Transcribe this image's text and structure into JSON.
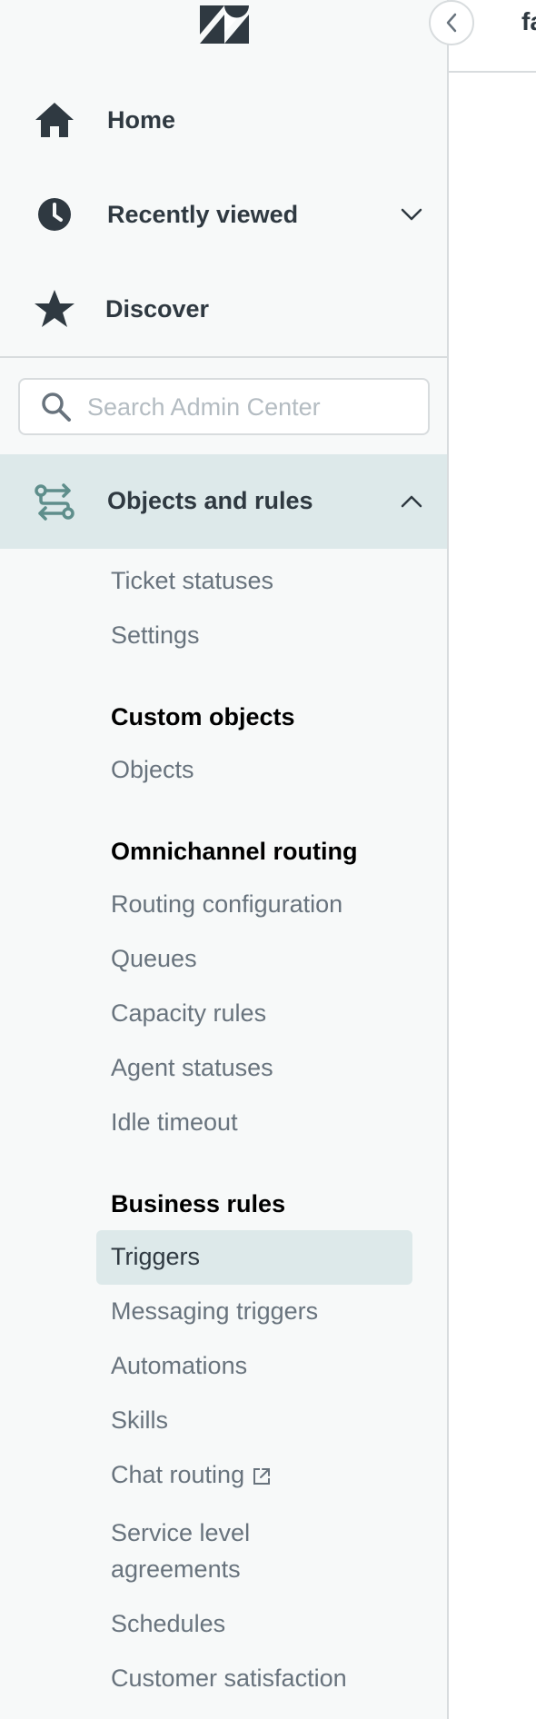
{
  "main": {
    "title": "fa"
  },
  "nav": {
    "home_label": "Home",
    "recent_label": "Recently viewed",
    "discover_label": "Discover",
    "section_label": "Objects and rules"
  },
  "search": {
    "placeholder": "Search Admin Center",
    "value": ""
  },
  "submenu": {
    "items": [
      "Ticket statuses",
      "Settings"
    ],
    "custom_objects": {
      "heading": "Custom objects",
      "items": [
        "Objects"
      ]
    },
    "omnichannel": {
      "heading": "Omnichannel routing",
      "items": [
        "Routing configuration",
        "Queues",
        "Capacity rules",
        "Agent statuses",
        "Idle timeout"
      ]
    },
    "business_rules": {
      "heading": "Business rules",
      "items": [
        "Triggers",
        "Messaging triggers",
        "Automations",
        "Skills",
        "Chat routing",
        "Service level",
        "agreements",
        "Schedules",
        "Customer satisfaction"
      ],
      "selected": "Triggers"
    }
  },
  "icons": {
    "logo": "zendesk-logo",
    "home": "home-icon",
    "recent": "clock-icon",
    "discover": "star-icon",
    "section": "objects-rules-icon",
    "search": "search-icon",
    "external": "external-link-icon"
  },
  "colors": {
    "sidebar_bg": "#f7f9f9",
    "active_bg": "#dde9ea",
    "text_dark": "#2f3941",
    "text_muted": "#68737d",
    "icon_teal": "#5e8e8b"
  }
}
